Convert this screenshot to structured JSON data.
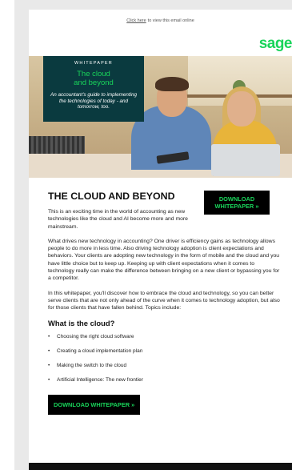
{
  "top_bar": {
    "link_text": "Click here",
    "trailing_text": "to view this email online"
  },
  "brand": {
    "logo_text": "sage",
    "accent_color": "#19d45a",
    "badge_color": "#0a3a3f"
  },
  "hero": {
    "kicker": "WHITEPAPER",
    "title_line1": "The cloud",
    "title_line2": "and beyond",
    "subtitle": "An accountant's guide to implementing the technologies of today - and tomorrow, too."
  },
  "cta_top": {
    "line1": "DOWNLOAD",
    "line2": "WHITEPAPER »"
  },
  "main": {
    "heading": "THE CLOUD AND BEYOND",
    "intro": "This is an exciting time in the world of accounting as new technologies like the cloud and AI become more and more mainstream.",
    "paragraph2": "What drives new technology in accounting? One driver is efficiency gains as technology allows people to do more in less time. Also driving technology adoption is client expectations and behaviors. Your clients are adopting new technology in the form of mobile and the cloud and you have little choice but to keep up. Keeping up with client expectations when it comes to technology really can make the difference between bringing on a new client or bypassing you for a competitor.",
    "paragraph3": "In this whitepaper, you'll discover how to embrace the cloud and technology, so you can better serve clients that are not only ahead of the curve when it comes to technology adoption, but also for those clients that have fallen behind. Topics include:",
    "subheading": "What is the cloud?",
    "topics": [
      "Choosing the right cloud software",
      "Creating a cloud implementation plan",
      "Making the switch to the cloud",
      "Artificial Intelligence: The new frontier"
    ],
    "cta_bottom": "DOWNLOAD WHITEPAPER »"
  }
}
